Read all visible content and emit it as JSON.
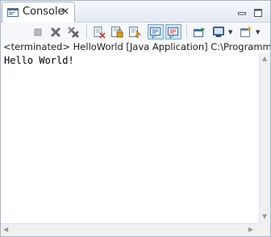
{
  "tab": {
    "label": "Console",
    "close": "✕",
    "icon": "console-icon"
  },
  "window_controls": {
    "minimize": "minimize-icon",
    "maximize": "maximize-icon"
  },
  "toolbar": {
    "buttons": [
      {
        "name": "terminate-button",
        "icon": "stop-icon"
      },
      {
        "name": "remove-launch-button",
        "icon": "remove-icon"
      },
      {
        "name": "remove-all-terminated-button",
        "icon": "remove-all-icon"
      },
      {
        "name": "clear-console-button",
        "icon": "clear-console-icon"
      },
      {
        "name": "scroll-lock-button",
        "icon": "scroll-lock-icon"
      },
      {
        "name": "word-wrap-button",
        "icon": "word-wrap-icon"
      },
      {
        "name": "show-on-stdout-button",
        "icon": "stdout-icon",
        "pressed": true
      },
      {
        "name": "show-on-stderr-button",
        "icon": "stderr-icon",
        "pressed": true
      },
      {
        "name": "pin-console-button",
        "icon": "pin-icon"
      },
      {
        "name": "display-selected-console-button",
        "icon": "monitor-icon"
      },
      {
        "name": "open-console-button",
        "icon": "new-console-icon"
      }
    ]
  },
  "status": {
    "text": "<terminated> HelloWorld [Java Application] C:\\Programme\\Ja"
  },
  "console": {
    "output": "Hello World!"
  },
  "colors": {
    "accent": "#cde3f7",
    "border": "#a9b6c8",
    "background": "#e9eef5"
  }
}
